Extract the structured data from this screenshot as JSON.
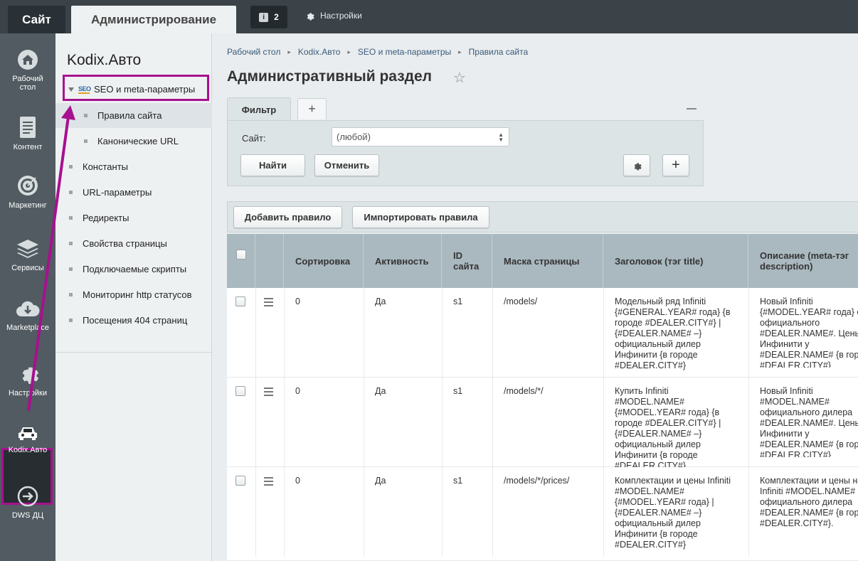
{
  "topbar": {
    "site_tab": "Сайт",
    "admin_tab": "Администрирование",
    "notifications_count": "2",
    "settings_label": "Настройки"
  },
  "leftnav": {
    "items": [
      {
        "label": "Рабочий стол",
        "icon": "home-icon"
      },
      {
        "label": "Контент",
        "icon": "document-icon"
      },
      {
        "label": "Маркетинг",
        "icon": "target-icon"
      },
      {
        "label": "Сервисы",
        "icon": "layers-icon"
      },
      {
        "label": "Marketplace",
        "icon": "cloud-download-icon"
      },
      {
        "label": "Настройки",
        "icon": "gear-icon"
      },
      {
        "label": "Kodix.Авто",
        "icon": "car-icon"
      },
      {
        "label": "DWS ДЦ",
        "icon": "arrow-circle-icon"
      }
    ]
  },
  "submenu": {
    "title": "Kodix.Авто",
    "seo_item": "SEO и meta-параметры",
    "items": [
      "Правила сайта",
      "Канонические URL",
      "Константы",
      "URL-параметры",
      "Редиректы",
      "Свойства страницы",
      "Подключаемые скрипты",
      "Мониторинг http статусов",
      "Посещения 404 страниц"
    ]
  },
  "breadcrumb": [
    "Рабочий стол",
    "Kodix.Авто",
    "SEO и meta-параметры",
    "Правила сайта"
  ],
  "page_title": "Административный раздел",
  "filter": {
    "tab_label": "Фильтр",
    "site_label": "Сайт:",
    "site_value": "(любой)",
    "find_button": "Найти",
    "cancel_button": "Отменить"
  },
  "toolbar": {
    "add_rule": "Добавить правило",
    "import_rules": "Импортировать правила"
  },
  "table": {
    "headers": {
      "sort": "Сортировка",
      "active": "Активность",
      "site_id": "ID сайта",
      "mask": "Маска страницы",
      "title": "Заголовок (тэг title)",
      "description": "Описание (meta-тэг description)"
    },
    "rows": [
      {
        "sort": "0",
        "active": "Да",
        "site": "s1",
        "mask": "/models/",
        "title": "Модельный ряд Infiniti {#GENERAL.YEAR# года} {в городе #DEALER.CITY#} | {#DEALER.NAME# –} официальный дилер Инфинити {в городе #DEALER.CITY#}",
        "description": "Новый Infiniti {#MODEL.YEAR# года} от официального #DEALER.NAME#. Цены Инфинити у #DEALER.NAME# {в городе #DEALER.CITY#}"
      },
      {
        "sort": "0",
        "active": "Да",
        "site": "s1",
        "mask": "/models/*/",
        "title": "Купить Infiniti #MODEL.NAME# {#MODEL.YEAR# года} {в городе #DEALER.CITY#} | {#DEALER.NAME# –} официальный дилер Инфинити {в городе #DEALER.CITY#}",
        "description": "Новый Infiniti #MODEL.NAME# официального дилера #DEALER.NAME#. Цены Инфинити у #DEALER.NAME# {в городе #DEALER.CITY#}"
      },
      {
        "sort": "0",
        "active": "Да",
        "site": "s1",
        "mask": "/models/*/prices/",
        "title": "Комплектации и цены Infiniti #MODEL.NAME# {#MODEL.YEAR# года} | {#DEALER.NAME# –} официальный дилер Инфинити {в городе #DEALER.CITY#}",
        "description": "Комплектации и цены на Infiniti #MODEL.NAME# официального дилера #DEALER.NAME# {в городе #DEALER.CITY#}."
      }
    ]
  },
  "colors": {
    "highlight": "#a8108f",
    "topbar": "#3b4348",
    "leftnav": "#515b61"
  }
}
